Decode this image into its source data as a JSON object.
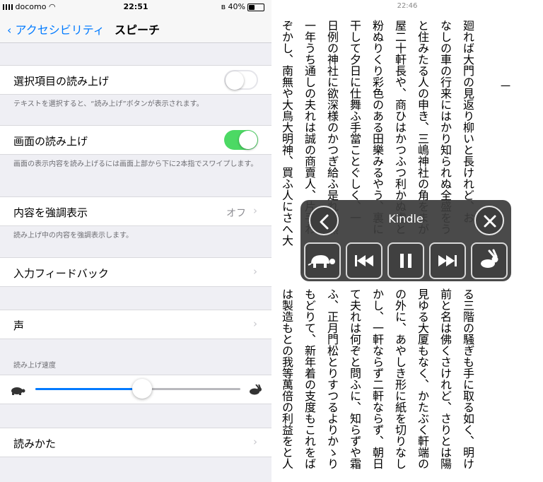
{
  "status": {
    "carrier": "docomo",
    "time": "22:51",
    "battery": "40%",
    "battery_level": 0.4
  },
  "nav": {
    "back_label": "アクセシビリティ",
    "title": "スピーチ"
  },
  "settings": {
    "speak_selection": {
      "label": "選択項目の読み上げ",
      "on": false,
      "note": "テキストを選択すると、“読み上げ”ボタンが表示されます。"
    },
    "speak_screen": {
      "label": "画面の読み上げ",
      "on": true,
      "note": "画面の表示内容を読み上げるには画面上部から下に2本指でスワイプします。"
    },
    "highlight": {
      "label": "内容を強調表示",
      "value": "オフ",
      "note": "読み上げ中の内容を強調表示します。"
    },
    "typing_feedback": {
      "label": "入力フィードバック"
    },
    "voices": {
      "label": "声"
    },
    "rate": {
      "header": "読み上げ速度",
      "value": 0.52
    },
    "pronunciations": {
      "label": "読みかた"
    }
  },
  "reader": {
    "time": "22:46",
    "page_mark": "一",
    "columns": [
      "廻れば大門の見返り柳いと長けれど、お",
      "なしの車の行来にはかり知られぬ全盛をう",
      "と住みたる人の申き、三嶋神社の角をまが",
      "屋二十軒長や、商ひはかつふつ利かぬ處と",
      "粉ぬりくり彩色のある田樂みるやう、裏に",
      "干して夕日に仕舞ふ手當ことぐしく、一",
      "日例の神社に欲深様のかつぎ給ふ是れぞ熊",
      "一年うち通しの夫れは誠の商賣人、片手わ",
      "ぞかし、南無や大鳥大明神、買ふ人にさへ大"
    ],
    "columns_bottom": [
      "る三階の騒ぎも手に取る如く、明けくれ",
      "前と名は佛くさけれど、さりとは陽氣の町",
      "見ゆる大厦もなく、かたぶく軒端の十軒長",
      "の外に、あやしき形に紙を切りなして、胡",
      "かし、一軒ならず二軒ならず、朝日に",
      "て夫れは何ぞと問ふに、知らずや霜月酉の",
      "ふ、正月門松とりすつるよりかゝりて、",
      "もどりて、新年着の支度もこれをば當て",
      "は製造もとの我等萬倍の利益をと人ごとに"
    ]
  },
  "speech_controller": {
    "title": "Kindle",
    "back_icon": "chevron-left-icon",
    "close_icon": "close-icon",
    "controls": [
      "turtle-icon",
      "skip-back-icon",
      "pause-icon",
      "skip-forward-icon",
      "rabbit-icon"
    ]
  },
  "colors": {
    "accent": "#007aff",
    "toggle_on": "#4cd964",
    "panel": "#3c3c3c"
  }
}
